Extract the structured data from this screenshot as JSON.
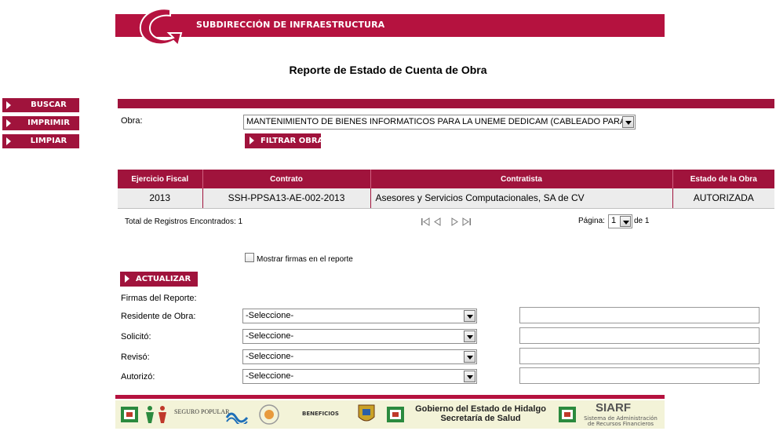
{
  "header": {
    "banner_title": "SUBDIRECCIÓN DE INFRAESTRUCTURA",
    "page_title": "Reporte de Estado de Cuenta de Obra"
  },
  "nav": {
    "buscar": "BUSCAR",
    "imprimir": "IMPRIMIR",
    "limpiar": "LIMPIAR"
  },
  "filter": {
    "obra_label": "Obra:",
    "obra_value": "MANTENIMIENTO DE BIENES INFORMATICOS PARA LA UNEME DEDICAM (CABLEADO PARA",
    "filter_button": "FILTRAR OBRAS"
  },
  "table": {
    "headers": [
      "Ejercicio Fiscal",
      "Contrato",
      "Contratista",
      "Estado de la Obra"
    ],
    "rows": [
      [
        "2013",
        "SSH-PPSA13-AE-002-2013",
        "Asesores y Servicios Computacionales, SA de CV",
        "AUTORIZADA"
      ]
    ]
  },
  "pager": {
    "total_label": "Total de Registros Encontrados: 1",
    "page_label": "Página:",
    "page_value": "1",
    "of_label": "de 1"
  },
  "signatures": {
    "show_checkbox_label": "Mostrar firmas en el reporte",
    "show_checked": false,
    "update_button": "ACTUALIZAR",
    "section_label": "Firmas del Reporte:",
    "rows": [
      {
        "label": "Residente de Obra:",
        "value": "-Seleccione-"
      },
      {
        "label": "Solicitó:",
        "value": "-Seleccione-"
      },
      {
        "label": "Revisó:",
        "value": "-Seleccione-"
      },
      {
        "label": "Autorizó:",
        "value": "-Seleccione-"
      }
    ]
  },
  "footer": {
    "seguro_popular": "SEGURO POPULAR",
    "beneficios": "BENEFICIOS",
    "gobierno_line1": "Gobierno del Estado de Hidalgo",
    "gobierno_line2": "Secretaría de Salud",
    "siarf": "SIARF",
    "siarf_sub1": "Sistema de Administración",
    "siarf_sub2": "de Recursos Financieros"
  },
  "colors": {
    "brand": "#a0133c",
    "banner": "#b5123f",
    "footer_bg": "#f3f3d8"
  }
}
